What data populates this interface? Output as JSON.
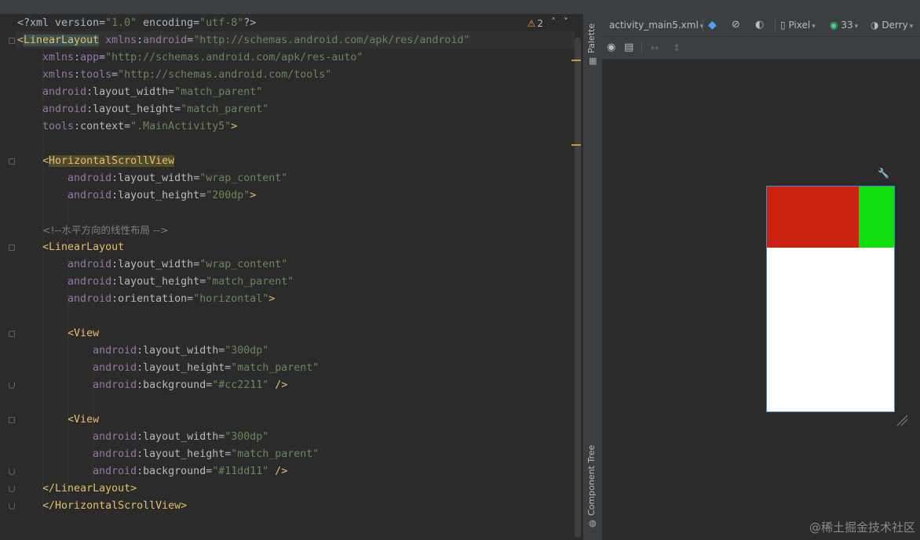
{
  "editor": {
    "warnings_count": "2",
    "nav_up": "˄",
    "nav_down": "˅",
    "lines": [
      {
        "parts": [
          [
            "plain",
            "<?xml version="
          ],
          [
            "val",
            "\"1.0\""
          ],
          [
            "plain",
            " encoding="
          ],
          [
            "val",
            "\"utf-8\""
          ],
          [
            "plain",
            "?>"
          ]
        ]
      },
      {
        "parts": [
          [
            "tag",
            "<"
          ],
          [
            "tagm",
            "LinearLayout"
          ],
          [
            "plain",
            " "
          ],
          [
            "ns",
            "xmlns"
          ],
          [
            "plain",
            ":"
          ],
          [
            "ns",
            "android"
          ],
          [
            "plain",
            "="
          ],
          [
            "val",
            "\"http://schemas.android.com/apk/res/android\""
          ]
        ]
      },
      {
        "parts": [
          [
            "plain",
            "    "
          ],
          [
            "ns",
            "xmlns"
          ],
          [
            "plain",
            ":"
          ],
          [
            "ns",
            "app"
          ],
          [
            "plain",
            "="
          ],
          [
            "val",
            "\"http://schemas.android.com/apk/res-auto\""
          ]
        ]
      },
      {
        "parts": [
          [
            "plain",
            "    "
          ],
          [
            "ns",
            "xmlns"
          ],
          [
            "plain",
            ":"
          ],
          [
            "ns",
            "tools"
          ],
          [
            "plain",
            "="
          ],
          [
            "val",
            "\"http://schemas.android.com/tools\""
          ]
        ]
      },
      {
        "parts": [
          [
            "plain",
            "    "
          ],
          [
            "ns",
            "android"
          ],
          [
            "plain",
            ":"
          ],
          [
            "attr",
            "layout_width"
          ],
          [
            "plain",
            "="
          ],
          [
            "val",
            "\"match_parent\""
          ]
        ]
      },
      {
        "parts": [
          [
            "plain",
            "    "
          ],
          [
            "ns",
            "android"
          ],
          [
            "plain",
            ":"
          ],
          [
            "attr",
            "layout_height"
          ],
          [
            "plain",
            "="
          ],
          [
            "val",
            "\"match_parent\""
          ]
        ]
      },
      {
        "parts": [
          [
            "plain",
            "    "
          ],
          [
            "ns",
            "tools"
          ],
          [
            "plain",
            ":"
          ],
          [
            "attr",
            "context"
          ],
          [
            "plain",
            "="
          ],
          [
            "val",
            "\".MainActivity5\""
          ],
          [
            "tag",
            ">"
          ]
        ]
      },
      {
        "parts": []
      },
      {
        "parts": [
          [
            "plain",
            "    "
          ],
          [
            "tag",
            "<"
          ],
          [
            "tagm2",
            "HorizontalScrollView"
          ]
        ]
      },
      {
        "parts": [
          [
            "plain",
            "        "
          ],
          [
            "ns",
            "android"
          ],
          [
            "plain",
            ":"
          ],
          [
            "attr",
            "layout_width"
          ],
          [
            "plain",
            "="
          ],
          [
            "val",
            "\"wrap_content\""
          ]
        ]
      },
      {
        "parts": [
          [
            "plain",
            "        "
          ],
          [
            "ns",
            "android"
          ],
          [
            "plain",
            ":"
          ],
          [
            "attr",
            "layout_height"
          ],
          [
            "plain",
            "="
          ],
          [
            "val",
            "\"200dp\""
          ],
          [
            "tag",
            ">"
          ]
        ]
      },
      {
        "parts": []
      },
      {
        "parts": [
          [
            "plain",
            "    "
          ],
          [
            "com",
            "<!--水平方向的线性布局 -->"
          ]
        ]
      },
      {
        "parts": [
          [
            "plain",
            "    "
          ],
          [
            "tag",
            "<LinearLayout"
          ]
        ]
      },
      {
        "parts": [
          [
            "plain",
            "        "
          ],
          [
            "ns",
            "android"
          ],
          [
            "plain",
            ":"
          ],
          [
            "attr",
            "layout_width"
          ],
          [
            "plain",
            "="
          ],
          [
            "val",
            "\"wrap_content\""
          ]
        ]
      },
      {
        "parts": [
          [
            "plain",
            "        "
          ],
          [
            "ns",
            "android"
          ],
          [
            "plain",
            ":"
          ],
          [
            "attr",
            "layout_height"
          ],
          [
            "plain",
            "="
          ],
          [
            "val",
            "\"match_parent\""
          ]
        ]
      },
      {
        "parts": [
          [
            "plain",
            "        "
          ],
          [
            "ns",
            "android"
          ],
          [
            "plain",
            ":"
          ],
          [
            "attr",
            "orientation"
          ],
          [
            "plain",
            "="
          ],
          [
            "val",
            "\"horizontal\""
          ],
          [
            "tag",
            ">"
          ]
        ]
      },
      {
        "parts": []
      },
      {
        "parts": [
          [
            "plain",
            "        "
          ],
          [
            "tag",
            "<View"
          ]
        ]
      },
      {
        "parts": [
          [
            "plain",
            "            "
          ],
          [
            "ns",
            "android"
          ],
          [
            "plain",
            ":"
          ],
          [
            "attr",
            "layout_width"
          ],
          [
            "plain",
            "="
          ],
          [
            "val",
            "\"300dp\""
          ]
        ]
      },
      {
        "parts": [
          [
            "plain",
            "            "
          ],
          [
            "ns",
            "android"
          ],
          [
            "plain",
            ":"
          ],
          [
            "attr",
            "layout_height"
          ],
          [
            "plain",
            "="
          ],
          [
            "val",
            "\"match_parent\""
          ]
        ]
      },
      {
        "parts": [
          [
            "plain",
            "            "
          ],
          [
            "ns",
            "android"
          ],
          [
            "plain",
            ":"
          ],
          [
            "attr",
            "background"
          ],
          [
            "plain",
            "="
          ],
          [
            "val",
            "\"#cc2211\""
          ],
          [
            "tag",
            " />"
          ]
        ]
      },
      {
        "parts": []
      },
      {
        "parts": [
          [
            "plain",
            "        "
          ],
          [
            "tag",
            "<View"
          ]
        ]
      },
      {
        "parts": [
          [
            "plain",
            "            "
          ],
          [
            "ns",
            "android"
          ],
          [
            "plain",
            ":"
          ],
          [
            "attr",
            "layout_width"
          ],
          [
            "plain",
            "="
          ],
          [
            "val",
            "\"300dp\""
          ]
        ]
      },
      {
        "parts": [
          [
            "plain",
            "            "
          ],
          [
            "ns",
            "android"
          ],
          [
            "plain",
            ":"
          ],
          [
            "attr",
            "layout_height"
          ],
          [
            "plain",
            "="
          ],
          [
            "val",
            "\"match_parent\""
          ]
        ]
      },
      {
        "parts": [
          [
            "plain",
            "            "
          ],
          [
            "ns",
            "android"
          ],
          [
            "plain",
            ":"
          ],
          [
            "attr",
            "background"
          ],
          [
            "plain",
            "="
          ],
          [
            "val",
            "\"#11dd11\""
          ],
          [
            "tag",
            " />"
          ]
        ]
      },
      {
        "parts": [
          [
            "plain",
            "    "
          ],
          [
            "tag",
            "</LinearLayout>"
          ]
        ]
      },
      {
        "parts": [
          [
            "plain",
            "    "
          ],
          [
            "tag",
            "</HorizontalScrollView>"
          ]
        ]
      }
    ]
  },
  "side_panel": {
    "palette_label": "Palette",
    "component_tree_label": "Component Tree"
  },
  "design_toolbar": {
    "file_name": "activity_main5.xml",
    "device": "Pixel",
    "api_level": "33",
    "theme": "Derry"
  },
  "preview": {
    "views": [
      {
        "color": "#cc2211"
      },
      {
        "color": "#11dd11"
      }
    ]
  },
  "watermark": "@稀土掘金技术社区",
  "colors": {
    "editor_bg": "#2b2b2b",
    "tag": "#e8bf6a",
    "namespace": "#9876aa",
    "value": "#6a8759",
    "comment": "#808080",
    "selection_border": "#4a88c7"
  }
}
